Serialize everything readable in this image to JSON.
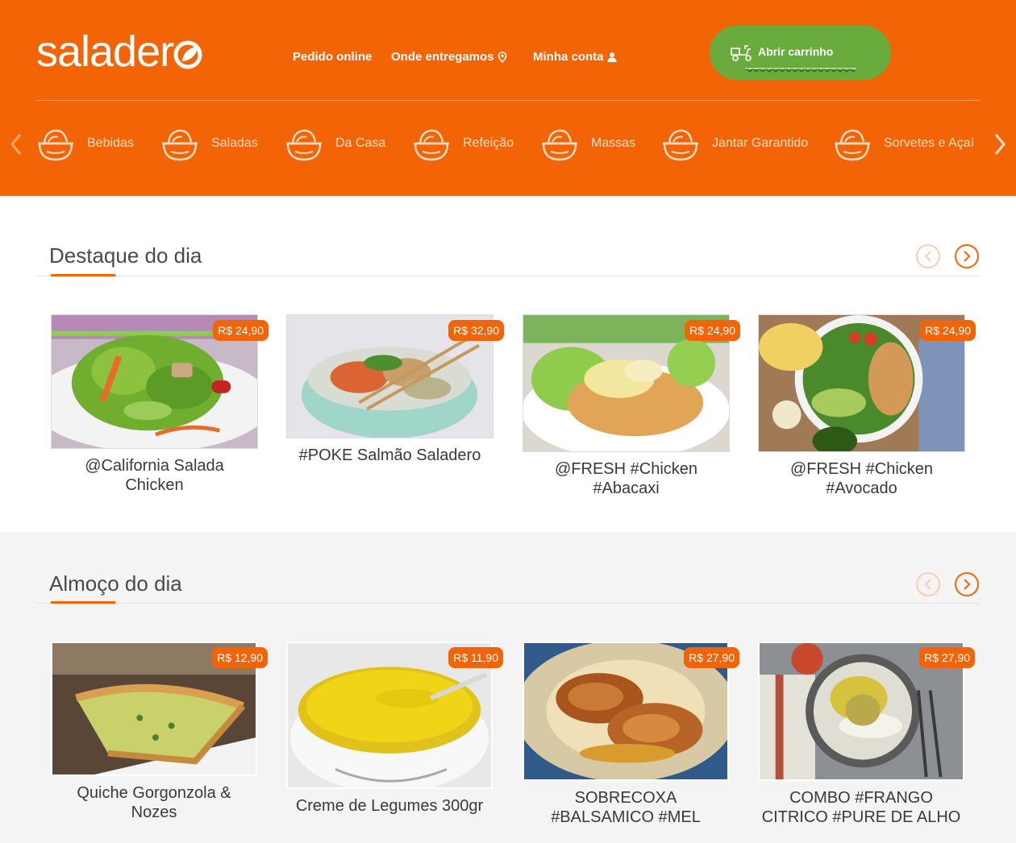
{
  "brand": {
    "logo_text": "salader"
  },
  "nav": {
    "pedido_online": "Pedido online",
    "onde_entregamos": "Onde entregamos",
    "minha_conta": "Minha conta"
  },
  "cart": {
    "label": "Abrir carrinho"
  },
  "categories": [
    {
      "label": "Bebidas",
      "icon": "bowl-icon"
    },
    {
      "label": "Saladas",
      "icon": "bowl-icon"
    },
    {
      "label": "Da Casa",
      "icon": "bowl-icon"
    },
    {
      "label": "Refeição",
      "icon": "bowl-icon"
    },
    {
      "label": "Massas",
      "icon": "bowl-icon"
    },
    {
      "label": "Jantar Garantido",
      "icon": "bowl-icon"
    },
    {
      "label": "Sorvetes e Açaí",
      "icon": "bowl-icon"
    }
  ],
  "sections": [
    {
      "title": "Destaque do dia",
      "items": [
        {
          "name": "@California Salada Chicken",
          "price": "R$ 24,90"
        },
        {
          "name": "#POKE Salmão Saladero",
          "price": "R$ 32,90"
        },
        {
          "name": "@FRESH #Chicken #Abacaxi",
          "price": "R$ 24,90"
        },
        {
          "name": "@FRESH #Chicken #Avocado",
          "price": "R$ 24,90"
        }
      ]
    },
    {
      "title": "Almoço do dia",
      "items": [
        {
          "name": "Quiche Gorgonzola & Nozes",
          "price": "R$ 12,90"
        },
        {
          "name": "Creme de Legumes 300gr",
          "price": "R$ 11,90"
        },
        {
          "name": "SOBRECOXA #BALSAMICO #MEL",
          "price": "R$ 27,90"
        },
        {
          "name": "COMBO #FRANGO CITRICO #PURE DE ALHO",
          "price": "R$ 27,90"
        }
      ]
    }
  ],
  "colors": {
    "brand_orange": "#f26405",
    "cart_green": "#6aab3d"
  }
}
